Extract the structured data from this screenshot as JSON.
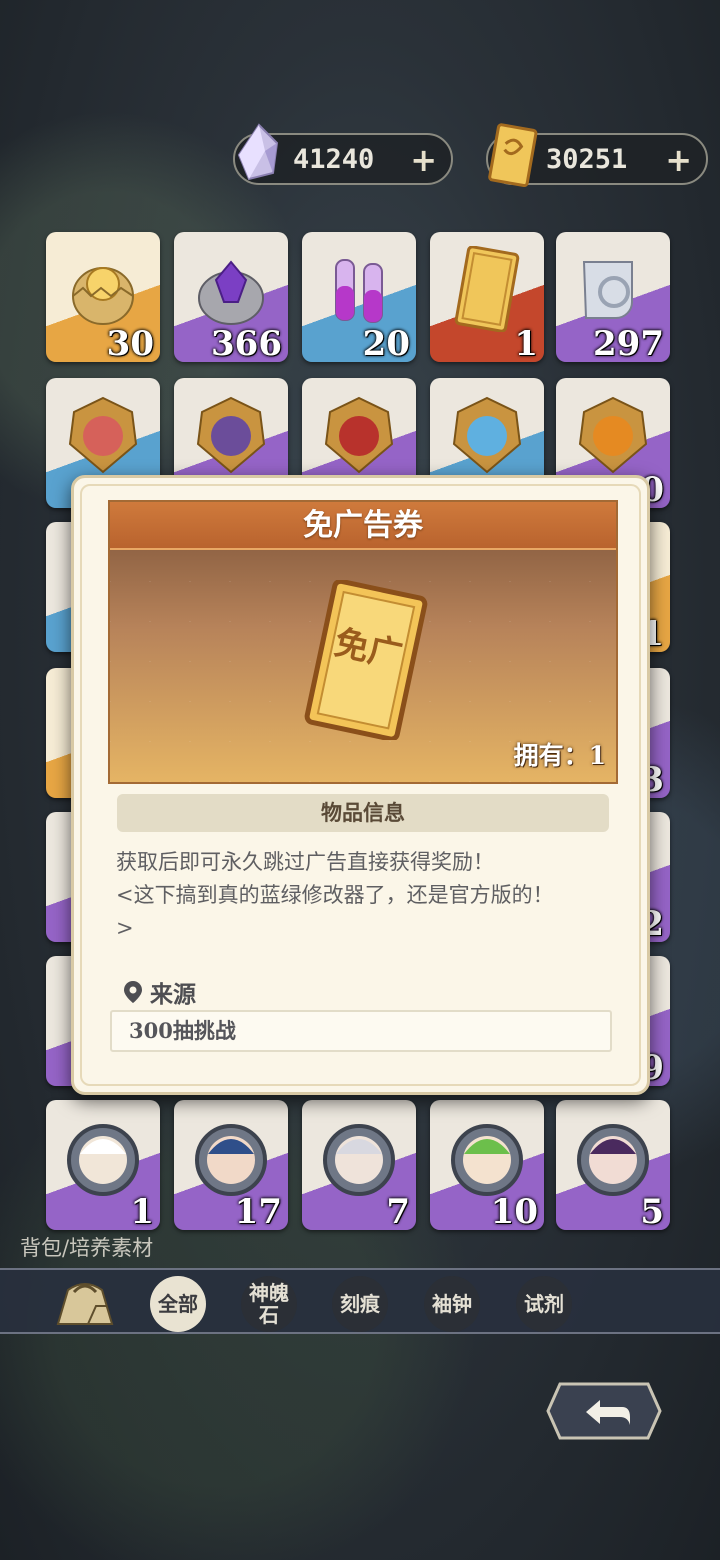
{
  "currencies": [
    {
      "icon": "crystal-icon",
      "value": "41240",
      "plus": "+"
    },
    {
      "icon": "ticket-currency-icon",
      "value": "30251",
      "plus": "+"
    }
  ],
  "inventory": {
    "items": [
      {
        "icon": "golden-egg-icon",
        "qty": "30",
        "rarity": "gold"
      },
      {
        "icon": "purple-egg-icon",
        "qty": "366",
        "rarity": "purple"
      },
      {
        "icon": "potion-vials-icon",
        "qty": "20",
        "rarity": "blue"
      },
      {
        "icon": "ad-free-ticket-icon",
        "qty": "1",
        "rarity": "red"
      },
      {
        "icon": "scroll-icon",
        "qty": "297",
        "rarity": "purple"
      },
      {
        "icon": "red-badge-icon",
        "qty": "",
        "rarity": "blue"
      },
      {
        "icon": "purple-badge-icon",
        "qty": "",
        "rarity": "purple"
      },
      {
        "icon": "crimson-badge-icon",
        "qty": "",
        "rarity": "purple"
      },
      {
        "icon": "blue-badge-icon",
        "qty": "",
        "rarity": "blue"
      },
      {
        "icon": "orange-badge-icon",
        "qty": "0",
        "rarity": "purple"
      }
    ],
    "right_edge_qty": [
      "1",
      "3",
      "2",
      "9"
    ],
    "portraits": [
      {
        "icon": "portrait-white-hair-icon",
        "qty": "1"
      },
      {
        "icon": "portrait-blue-hair-icon",
        "qty": "17"
      },
      {
        "icon": "portrait-silver-hair-icon",
        "qty": "7"
      },
      {
        "icon": "portrait-green-hair-icon",
        "qty": "10"
      },
      {
        "icon": "portrait-purple-hair-icon",
        "qty": "5"
      }
    ]
  },
  "modal": {
    "title": "免广告券",
    "ticket_glyph": "免广",
    "owned": "拥有：1",
    "info_header": "物品信息",
    "description_line1": "获取后即可永久跳过广告直接获得奖励！",
    "description_line2": "<这下搞到真的蓝绿修改器了，还是官方版的！",
    "description_line3": ">",
    "source_label": "来源",
    "source_value": "300抽挑战"
  },
  "bottom": {
    "breadcrumb": "背包/培养素材",
    "tabs": [
      {
        "label": "全部",
        "active": true
      },
      {
        "label": "神魄石",
        "active": false
      },
      {
        "label": "刻痕",
        "active": false
      },
      {
        "label": "袖钟",
        "active": false
      },
      {
        "label": "试剂",
        "active": false
      }
    ]
  },
  "colors": {
    "accent_orange": "#cf7a3c",
    "rarity_gold": "#e7a644",
    "rarity_purple": "#9564c7",
    "rarity_blue": "#59a2cf",
    "rarity_red": "#c4472c"
  }
}
